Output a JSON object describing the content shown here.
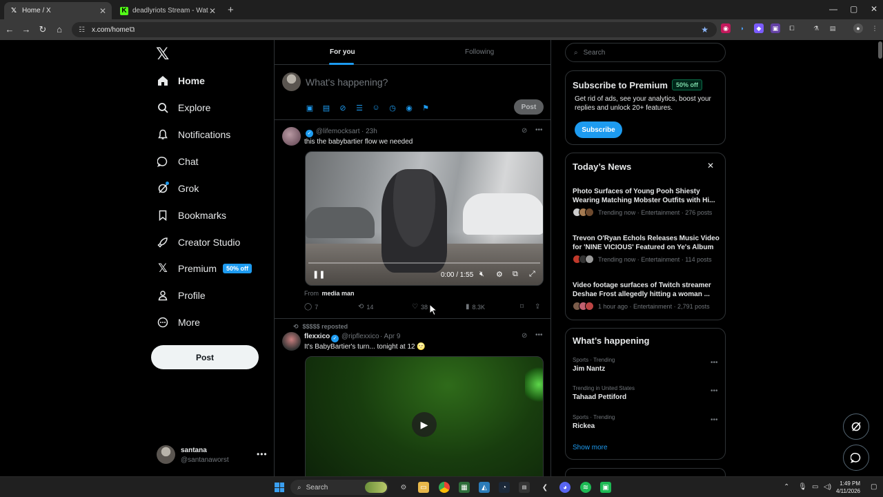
{
  "browser": {
    "tabs": [
      {
        "title": "Home / X",
        "favicon": "x-logo-icon",
        "active": true
      },
      {
        "title": "deadlyriots Stream - Watch Live",
        "favicon": "kick-logo-icon",
        "active": false
      }
    ],
    "url": "x.com/home"
  },
  "sidebar": {
    "logo": "𝕏",
    "items": [
      {
        "label": "Home",
        "icon": "home-icon"
      },
      {
        "label": "Explore",
        "icon": "search-icon"
      },
      {
        "label": "Notifications",
        "icon": "bell-icon"
      },
      {
        "label": "Chat",
        "icon": "chat-icon"
      },
      {
        "label": "Grok",
        "icon": "grok-icon"
      },
      {
        "label": "Bookmarks",
        "icon": "bookmark-icon"
      },
      {
        "label": "Creator Studio",
        "icon": "rocket-icon"
      },
      {
        "label": "Premium",
        "icon": "x-icon",
        "badge": "50% off"
      },
      {
        "label": "Profile",
        "icon": "person-icon"
      },
      {
        "label": "More",
        "icon": "more-circle-icon"
      }
    ],
    "post_label": "Post",
    "account": {
      "name": "santana",
      "handle": "@santanaworst"
    }
  },
  "feed": {
    "tabs": [
      "For you",
      "Following"
    ],
    "composer": {
      "placeholder": "What's happening?",
      "post_label": "Post"
    },
    "tweets": [
      {
        "name": "",
        "handle": "@lifemocksart",
        "time": "· 23h",
        "text": "this the babybartier flow we needed",
        "video_time": "0:00 / 1:55",
        "from_prefix": "From",
        "from_name": "media man",
        "replies": "7",
        "reposts": "14",
        "likes": "38",
        "views": "8.3K"
      },
      {
        "repost_by": "$$$$$ reposted",
        "name": "flexxico",
        "handle": "@ripflexxico",
        "time": "· Apr 9",
        "text": "It's BabyBartier's turn... tonight at 12 🌝"
      }
    ]
  },
  "right": {
    "search_placeholder": "Search",
    "premium": {
      "title": "Subscribe to Premium",
      "badge": "50% off",
      "description": "Get rid of ads, see your analytics, boost your replies and unlock 20+ features.",
      "button": "Subscribe"
    },
    "news": {
      "title": "Today’s News",
      "items": [
        {
          "headline": "Photo Surfaces of Young Pooh Shiesty Wearing Matching Mobster Outfits with Hi...",
          "meta": "Trending now · Entertainment · 276 posts"
        },
        {
          "headline": "Trevon O'Ryan Echols Releases Music Video for 'NINE VICIOUS' Featured on Ye's Album",
          "meta": "Trending now · Entertainment · 114 posts"
        },
        {
          "headline": "Video footage surfaces of Twitch streamer Deshae Frost allegedly hitting a woman ...",
          "meta": "1 hour ago · Entertainment · 2,791 posts"
        }
      ]
    },
    "happening": {
      "title": "What’s happening",
      "items": [
        {
          "context": "Sports · Trending",
          "name": "Jim Nantz"
        },
        {
          "context": "Trending in United States",
          "name": "Tahaad Pettiford"
        },
        {
          "context": "Sports · Trending",
          "name": "Rickea"
        }
      ],
      "show_more": "Show more"
    }
  },
  "taskbar": {
    "search_label": "Search",
    "time": "1:49 PM",
    "date": "4/11/2026"
  }
}
